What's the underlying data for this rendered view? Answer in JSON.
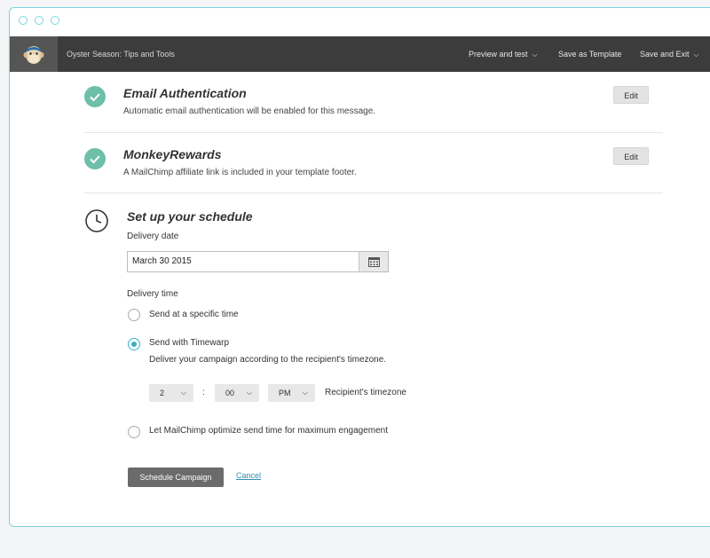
{
  "app": {
    "campaign_title": "Oyster Season: Tips and Tools",
    "menu": {
      "preview": "Preview and test",
      "save_template": "Save as Template",
      "save_exit": "Save and Exit"
    }
  },
  "sections": {
    "auth": {
      "title": "Email Authentication",
      "desc": "Automatic email authentication will be enabled for this message.",
      "edit": "Edit"
    },
    "rewards": {
      "title": "MonkeyRewards",
      "desc": "A MailChimp affiliate link is included in your template footer.",
      "edit": "Edit"
    }
  },
  "schedule": {
    "title": "Set up your schedule",
    "delivery_date_label": "Delivery date",
    "delivery_date_value": "March 30 2015",
    "delivery_time_label": "Delivery time",
    "options": {
      "specific": "Send at a specific time",
      "timewarp": "Send with Timewarp",
      "timewarp_desc": "Deliver your campaign according to the recipient's timezone.",
      "optimize": "Let MailChimp optimize send time for maximum engagement"
    },
    "time": {
      "hour": "2",
      "separator": ":",
      "minute": "00",
      "ampm": "PM",
      "timezone_label": "Recipient's timezone"
    },
    "schedule_button": "Schedule Campaign",
    "cancel_link": "Cancel"
  },
  "colors": {
    "accent": "#3ab0c7",
    "check": "#6dbfa8",
    "topbar": "#3c3c3c"
  }
}
